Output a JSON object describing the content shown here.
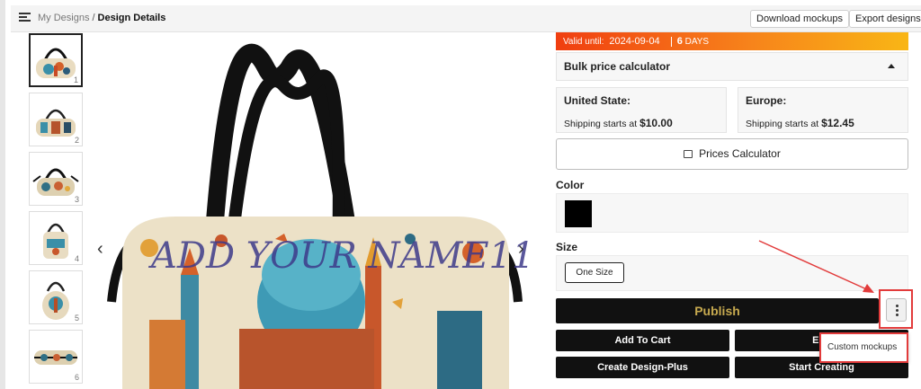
{
  "header": {
    "breadcrumb_link": "My Designs",
    "breadcrumb_sep": "/",
    "breadcrumb_current": "Design Details",
    "download_label": "Download mockups",
    "export_label": "Export designs"
  },
  "thumbnails": [
    "1",
    "2",
    "3",
    "4",
    "5",
    "6"
  ],
  "main_image": {
    "overlay_text": "ADD YOUR NAME11"
  },
  "panel": {
    "valid_label": "Valid until:",
    "valid_date": "2024-09-04",
    "days_count": "6",
    "days_label": "DAYS",
    "bulk_label": "Bulk price calculator",
    "shipping": [
      {
        "region": "United State:",
        "prefix": "Shipping starts at",
        "price": "$10.00"
      },
      {
        "region": "Europe:",
        "prefix": "Shipping starts at",
        "price": "$12.45"
      }
    ],
    "prices_calc_label": "Prices Calculator",
    "color_label": "Color",
    "selected_color": "#000000",
    "size_label": "Size",
    "size_option": "One Size",
    "publish_label": "Publish",
    "add_to_cart_label": "Add To Cart",
    "edit_label": "Edit",
    "create_plus_label": "Create Design-Plus",
    "start_creating_label": "Start Creating",
    "dropdown_item": "Custom mockups"
  },
  "colors": {
    "accent_red": "#e23b3b",
    "publish_text": "#c6a94f",
    "banner_start": "#f03e10",
    "banner_end": "#f9b615"
  },
  "icons": [
    "menu-icon",
    "chevron-left-icon",
    "chevron-right-icon",
    "image-icon",
    "caret-up-icon",
    "more-vertical-icon"
  ]
}
